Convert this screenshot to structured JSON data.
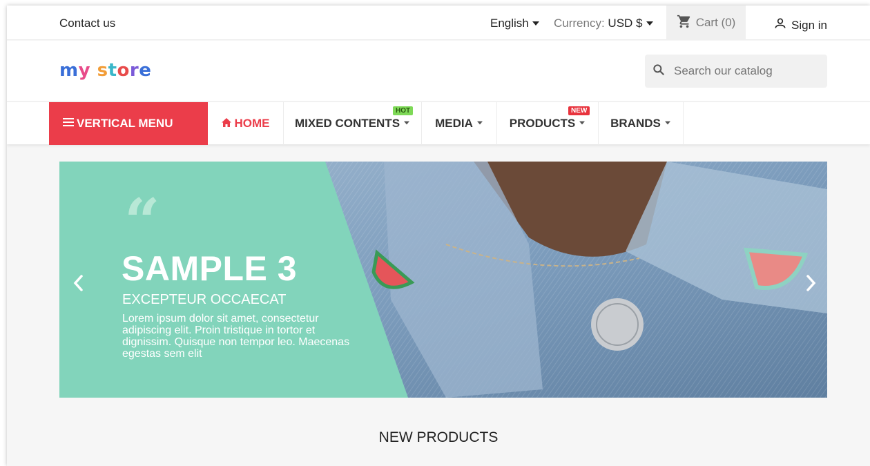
{
  "topbar": {
    "contact": "Contact us",
    "language": "English",
    "currency_label": "Currency:",
    "currency_value": "USD $",
    "cart": "Cart (0)",
    "signin": "Sign in"
  },
  "header": {
    "logo": "my store",
    "search_placeholder": "Search our catalog"
  },
  "nav": {
    "vertical_menu": "VERTICAL MENU",
    "items": [
      {
        "label": "HOME",
        "icon": "home-icon"
      },
      {
        "label": "MIXED CONTENTS",
        "badge": "HOT"
      },
      {
        "label": "MEDIA"
      },
      {
        "label": "PRODUCTS",
        "badge": "NEW"
      },
      {
        "label": "BRANDS"
      }
    ]
  },
  "slider": {
    "title": "SAMPLE 3",
    "subtitle": "EXCEPTEUR OCCAECAT",
    "text": "Lorem ipsum dolor sit amet, consectetur adipiscing elit. Proin tristique in tortor et dignissim. Quisque non tempor leo. Maecenas egestas sem elit",
    "accent_color": "#82d4bb"
  },
  "sections": {
    "new_products": "NEW PRODUCTS"
  },
  "colors": {
    "brand_red": "#eb3d4a",
    "hot_badge": "#7ed957",
    "new_badge": "#e8333d"
  }
}
